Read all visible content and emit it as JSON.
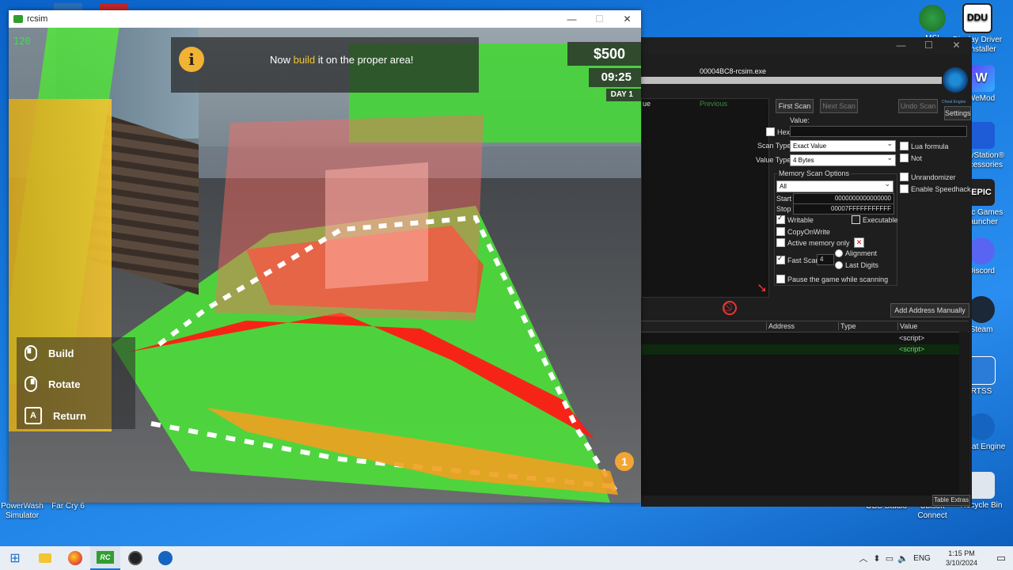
{
  "desktop": {
    "icons_right": [
      {
        "label": "MSI",
        "id": "msi"
      },
      {
        "label": "Display Driver Uninstaller",
        "id": "ddu"
      },
      {
        "label": "WeMod",
        "id": "wemod"
      },
      {
        "label": "PlayStation® Accessories",
        "id": "ps"
      },
      {
        "label": "Epic Games Launcher",
        "id": "epic"
      },
      {
        "label": "Discord",
        "id": "discord"
      },
      {
        "label": "Steam",
        "id": "steam"
      },
      {
        "label": "RTSS",
        "id": "rtss"
      },
      {
        "label": "Cheat Engine",
        "id": "ce"
      },
      {
        "label": "Recycle Bin",
        "id": "bin"
      }
    ],
    "icons_bottom": [
      {
        "label": "PowerWash Simulator"
      },
      {
        "label": "Far Cry 6"
      },
      {
        "label": "OBS Studio"
      },
      {
        "label": "Ubisoft Connect"
      }
    ]
  },
  "game_window": {
    "title": "rcsim",
    "fps": "120",
    "hint_prefix": "Now ",
    "hint_highlight": "build",
    "hint_suffix": " it on the proper area!",
    "money": "$500",
    "time": "09:25",
    "day": "DAY 1",
    "marker": "1",
    "controls": [
      {
        "key": "mouse-left",
        "label": "Build"
      },
      {
        "key": "mouse-right",
        "label": "Rotate"
      },
      {
        "key": "A",
        "label": "Return"
      }
    ]
  },
  "cheat_engine": {
    "process": "00004BC8-rcsim.exe",
    "list_cols": [
      "ue",
      "Previous"
    ],
    "first_scan": "First Scan",
    "next_scan": "Next Scan",
    "undo_scan": "Undo Scan",
    "settings": "Settings",
    "value_label": "Value:",
    "hex": "Hex",
    "scan_type_label": "Scan Type",
    "scan_type": "Exact Value",
    "value_type_label": "Value Type",
    "value_type": "4 Bytes",
    "lua_formula": "Lua formula",
    "not": "Not",
    "memory_options": "Memory Scan Options",
    "region": "All",
    "start_label": "Start",
    "start_value": "0000000000000000",
    "stop_label": "Stop",
    "stop_value": "00007FFFFFFFFFFF",
    "writable": "Writable",
    "executable": "Executable",
    "copyonwrite": "CopyOnWrite",
    "active_memory": "Active memory only",
    "fast_scan": "Fast Scan",
    "fast_scan_value": "4",
    "alignment": "Alignment",
    "last_digits": "Last Digits",
    "pause_game": "Pause the game while scanning",
    "unrandomizer": "Unrandomizer",
    "speedhack": "Enable Speedhack",
    "add_address": "Add Address Manually",
    "table_cols": {
      "address": "Address",
      "type": "Type",
      "value": "Value"
    },
    "rows": [
      "<script>",
      "<script>"
    ],
    "table_extras": "Table Extras",
    "logo_caption": "Cheat Engine"
  },
  "taskbar": {
    "language": "ENG",
    "time": "1:15 PM",
    "date": "3/10/2024"
  }
}
